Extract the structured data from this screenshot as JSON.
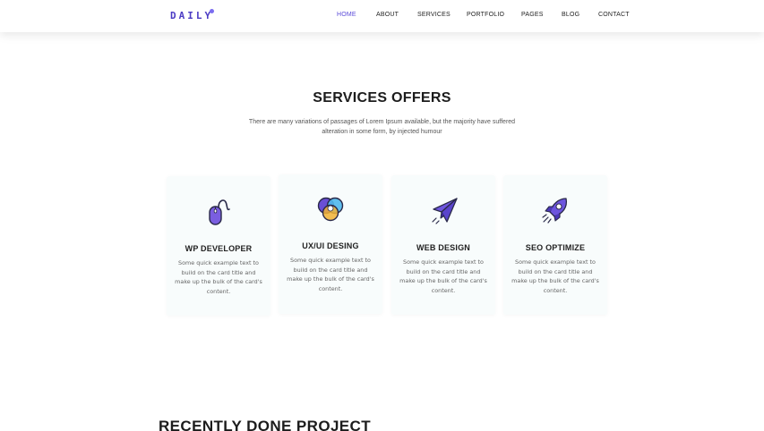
{
  "brand": {
    "logo_text": "DAILY"
  },
  "nav": {
    "items": [
      {
        "label": "HOME",
        "active": true
      },
      {
        "label": "ABOUT",
        "active": false
      },
      {
        "label": "SERVICES",
        "active": false
      },
      {
        "label": "PORTFOLIO",
        "active": false
      },
      {
        "label": "PAGES",
        "active": false
      },
      {
        "label": "BLOG",
        "active": false
      },
      {
        "label": "CONTACT",
        "active": false
      }
    ]
  },
  "services": {
    "title": "SERVICES OFFERS",
    "subtitle": "There are many variations of passages of Lorem Ipsum available, but the majority have suffered alteration in some form, by injected humour",
    "cards": [
      {
        "icon": "mouse-icon",
        "title": "WP DEVELOPER",
        "text": "Some quick example text to build on the card title and make up the bulk of the card's content."
      },
      {
        "icon": "color-circles-icon",
        "title": "UX/UI DESING",
        "text": "Some quick example text to build on the card title and make up the bulk of the card's content."
      },
      {
        "icon": "paper-plane-icon",
        "title": "WEB DESIGN",
        "text": "Some quick example text to build on the card title and make up the bulk of the card's content."
      },
      {
        "icon": "rocket-icon",
        "title": "SEO OPTIMIZE",
        "text": "Some quick example text to build on the card title and make up the bulk of the card's content."
      }
    ]
  },
  "projects": {
    "title": "RECENTLY DONE PROJECT"
  },
  "colors": {
    "accent": "#5a4ad8",
    "accent_light": "#7b6df0",
    "card_bg": "#f8fcfc"
  }
}
